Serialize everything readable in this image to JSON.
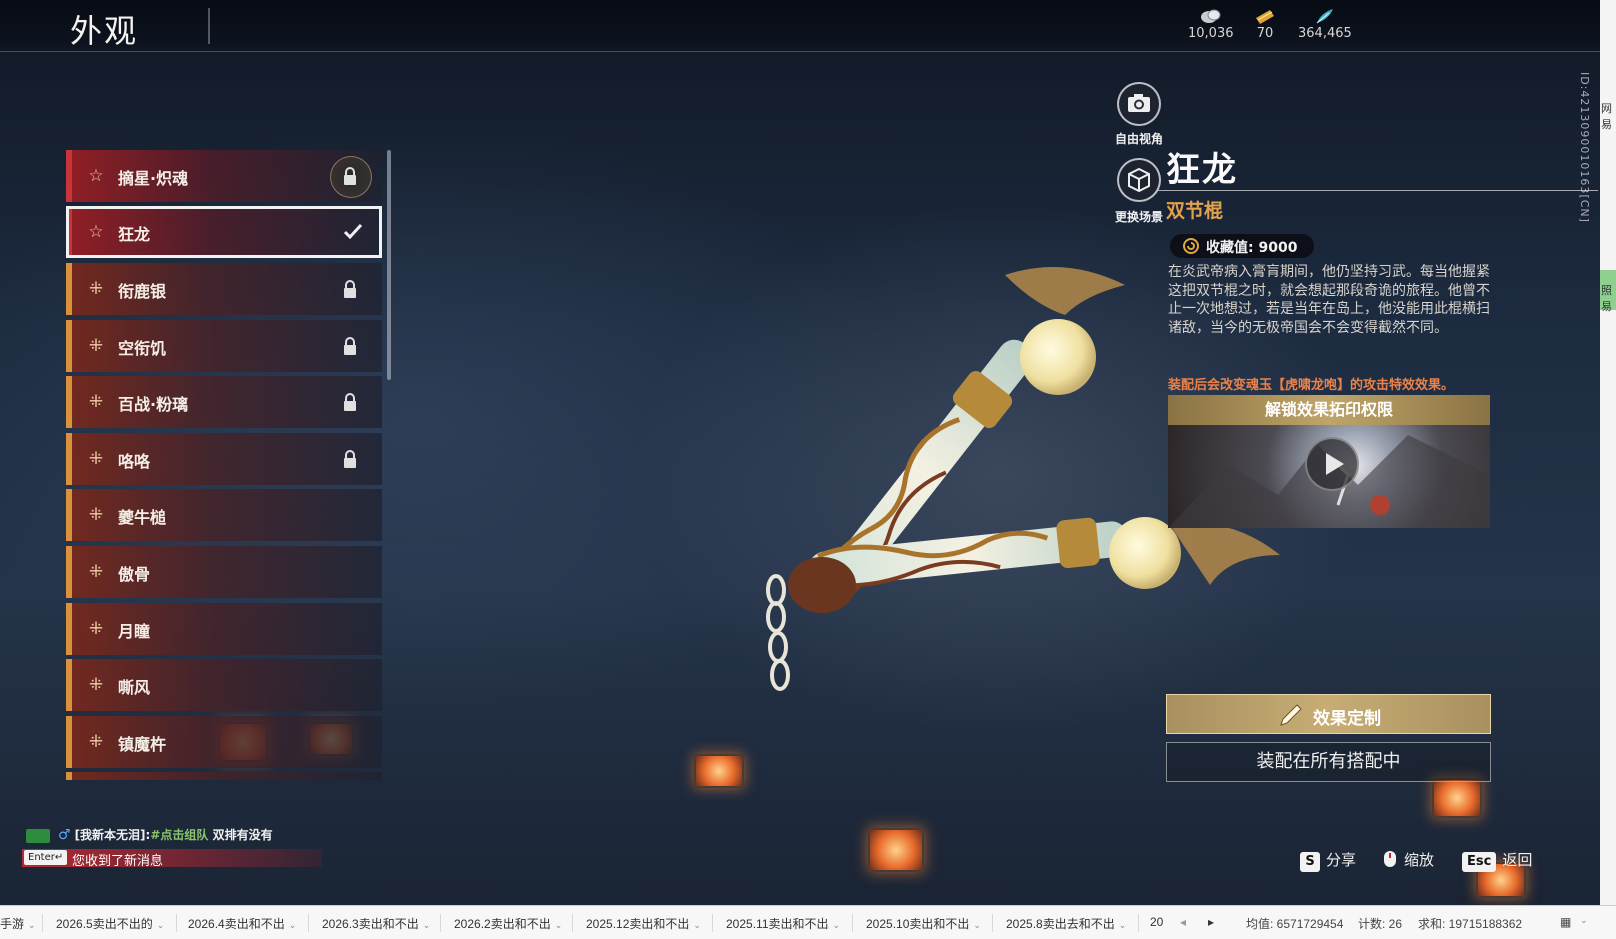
{
  "header": {
    "title": "外观",
    "currencies": [
      {
        "icon": "silver-coin-icon",
        "value": "10,036"
      },
      {
        "icon": "gold-ticket-icon",
        "value": "70"
      },
      {
        "icon": "feather-token-icon",
        "value": "364,465"
      }
    ]
  },
  "account_id": "ID:4213090010163[CN]",
  "view_buttons": {
    "free_camera": "自由视角",
    "change_scene": "更换场景"
  },
  "items": [
    {
      "label": "摘星·炽魂",
      "state": "locked",
      "rarity": "red"
    },
    {
      "label": "狂龙",
      "state": "equipped",
      "rarity": "red"
    },
    {
      "label": "衔鹿银",
      "state": "locked",
      "rarity": "orange"
    },
    {
      "label": "空衔饥",
      "state": "locked",
      "rarity": "orange"
    },
    {
      "label": "百战·粉璃",
      "state": "locked",
      "rarity": "orange"
    },
    {
      "label": "咯咯",
      "state": "locked",
      "rarity": "orange"
    },
    {
      "label": "夔牛槌",
      "state": "owned",
      "rarity": "orange"
    },
    {
      "label": "傲骨",
      "state": "owned",
      "rarity": "orange"
    },
    {
      "label": "月瞳",
      "state": "owned",
      "rarity": "orange"
    },
    {
      "label": "嘶风",
      "state": "owned",
      "rarity": "orange"
    },
    {
      "label": "镇魔杵",
      "state": "owned",
      "rarity": "orange"
    }
  ],
  "detail": {
    "name": "狂龙",
    "type": "双节棍",
    "collection_label": "收藏值: 9000",
    "description": "在炎武帝病入膏肓期间，他仍坚持习武。每当他握紧这把双节棍之时，就会想起那段奇诡的旅程。他曾不止一次地想过，若是当年在岛上，他没能用此棍横扫诸敌，当今的无极帝国会不会变得截然不同。",
    "equip_note": "装配后会改变魂玉【虎啸龙咆】的攻击特效效果。",
    "unlock_header": "解锁效果拓印权限",
    "customize_label": "效果定制",
    "equip_all_label": "装配在所有搭配中"
  },
  "chat": {
    "line1_channel": "[我新本无泪]:",
    "line1_team": "#点击组队",
    "line1_text": " 双排有没有",
    "enter_key": "Enter↵",
    "line2_text": "您收到了新消息"
  },
  "hotkeys": [
    {
      "key": "S",
      "label": "分享"
    },
    {
      "key": "",
      "label": "缩放"
    },
    {
      "key": "Esc",
      "label": "返回"
    }
  ],
  "side_strip": {
    "text_a": "网易",
    "text_b": "照易"
  },
  "sheet_bar": {
    "tabs": [
      "手游",
      "2026.5卖出不出的",
      "2026.4卖出和不出",
      "2026.3卖出和不出",
      "2026.2卖出和不出",
      "2025.12卖出和不出",
      "2025.11卖出和不出",
      "2025.10卖出和不出",
      "2025.8卖出去和不出",
      "20"
    ],
    "avg": "均值: 6571729454",
    "count": "计数: 26",
    "sum": "求和: 19715188362"
  }
}
